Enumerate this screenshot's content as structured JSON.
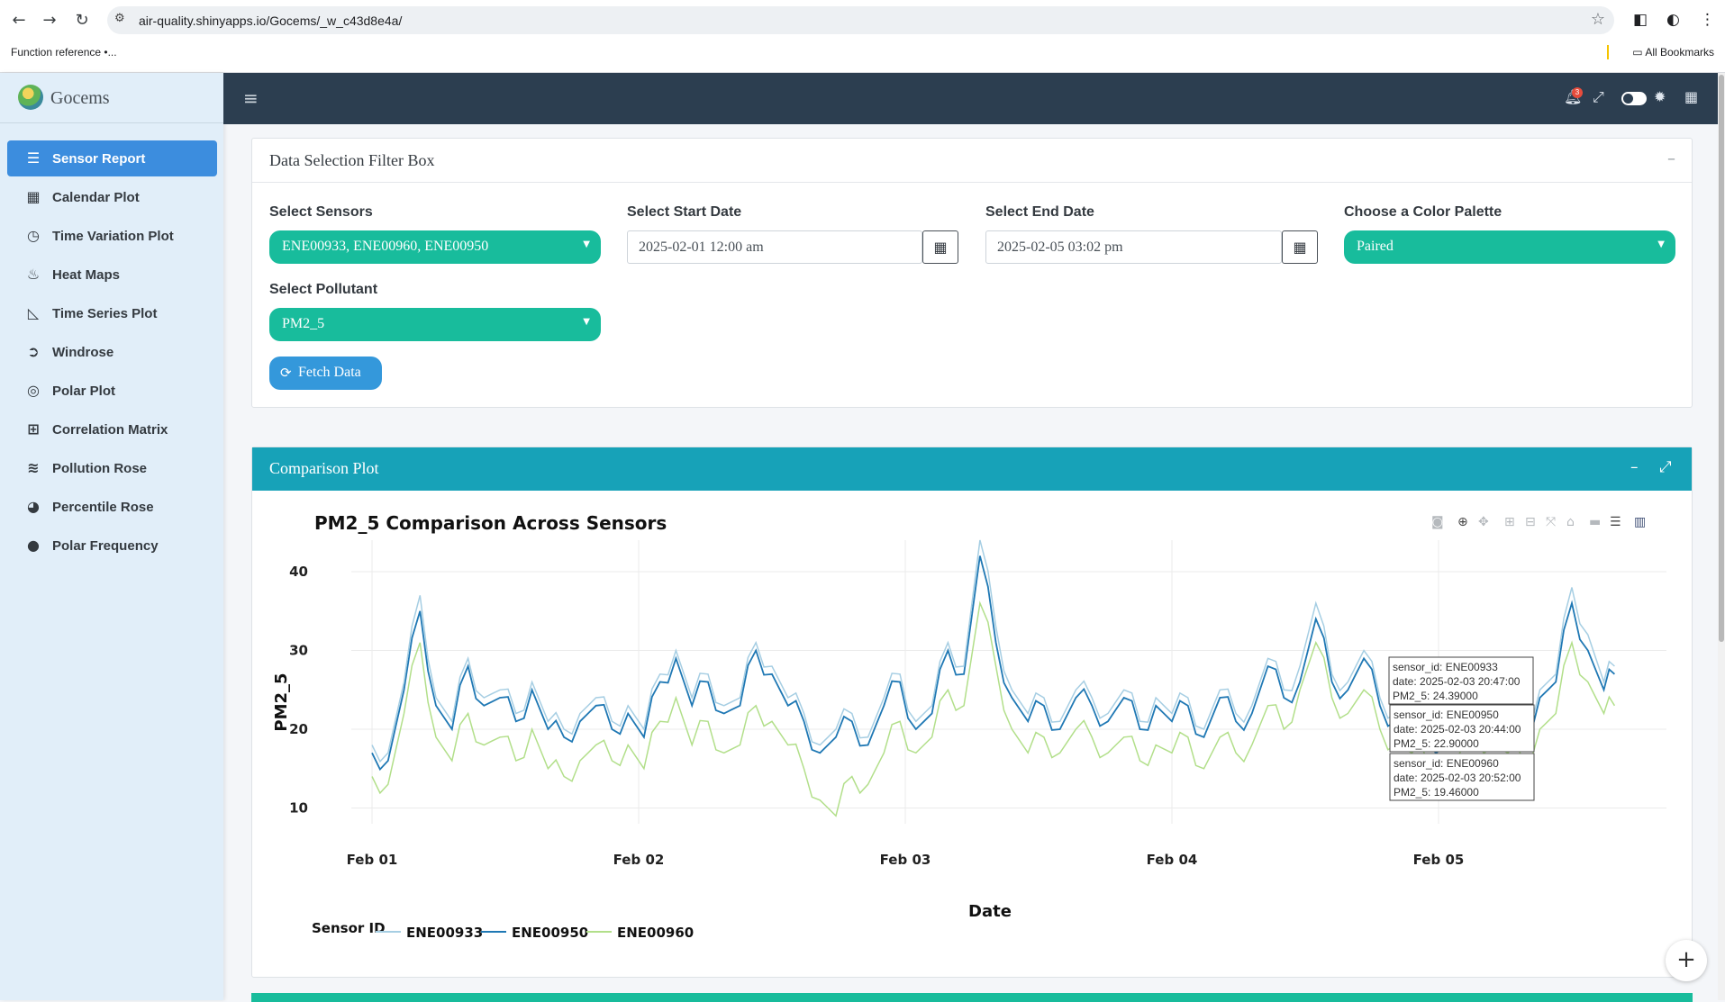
{
  "browser": {
    "back_icon": "←",
    "forward_icon": "→",
    "reload_icon": "↻",
    "url": "air-quality.shinyapps.io/Gocems/_w_c43d8e4a/",
    "bookmark": "Function reference •...",
    "all_bookmarks": "All Bookmarks"
  },
  "sidebar": {
    "brand": "Gocems",
    "items": [
      {
        "label": "Sensor Report",
        "icon": "list-icon"
      },
      {
        "label": "Calendar Plot",
        "icon": "calendar-icon"
      },
      {
        "label": "Time Variation Plot",
        "icon": "clock-icon"
      },
      {
        "label": "Heat Maps",
        "icon": "fire-icon"
      },
      {
        "label": "Time Series Plot",
        "icon": "area-chart-icon"
      },
      {
        "label": "Windrose",
        "icon": "arrow-circle-icon"
      },
      {
        "label": "Polar Plot",
        "icon": "compass-icon"
      },
      {
        "label": "Correlation Matrix",
        "icon": "sitemap-icon"
      },
      {
        "label": "Pollution Rose",
        "icon": "wind-icon"
      },
      {
        "label": "Percentile Rose",
        "icon": "pie-icon"
      },
      {
        "label": "Polar Frequency",
        "icon": "circle-icon"
      }
    ]
  },
  "navbar": {
    "notification_count": "3"
  },
  "filter_box": {
    "title": "Data Selection Filter Box",
    "sensors_label": "Select Sensors",
    "sensors_value": "ENE00933, ENE00960, ENE00950",
    "start_label": "Select Start Date",
    "start_value": "2025-02-01 12:00 am",
    "end_label": "Select End Date",
    "end_value": "2025-02-05 03:02 pm",
    "palette_label": "Choose a Color Palette",
    "palette_value": "Paired",
    "pollutant_label": "Select Pollutant",
    "pollutant_value": "PM2_5",
    "fetch_label": "Fetch Data"
  },
  "comparison": {
    "header": "Comparison Plot"
  },
  "chart_data": {
    "type": "line",
    "title": "PM2_5 Comparison Across Sensors",
    "xlabel": "Date",
    "ylabel": "PM2_5",
    "x_ticks": [
      "Feb 01",
      "Feb 02",
      "Feb 03",
      "Feb 04",
      "Feb 05"
    ],
    "y_ticks": [
      10,
      20,
      30,
      40
    ],
    "ylim": [
      8,
      44
    ],
    "xlim_days": [
      0,
      5.25
    ],
    "grid": true,
    "legend_title": "Sensor ID",
    "legend_position": "bottom-left",
    "series": [
      {
        "name": "ENE00933",
        "color": "#a6cee3",
        "x": [
          0.0,
          0.06,
          0.12,
          0.18,
          0.24,
          0.3,
          0.36,
          0.42,
          0.48,
          0.54,
          0.6,
          0.66,
          0.72,
          0.78,
          0.84,
          0.9,
          0.96,
          1.02,
          1.08,
          1.14,
          1.2,
          1.26,
          1.32,
          1.38,
          1.44,
          1.5,
          1.56,
          1.62,
          1.68,
          1.74,
          1.8,
          1.86,
          1.92,
          1.98,
          2.04,
          2.1,
          2.16,
          2.22,
          2.28,
          2.34,
          2.4,
          2.46,
          2.52,
          2.58,
          2.64,
          2.7,
          2.76,
          2.82,
          2.88,
          2.94,
          3.0,
          3.06,
          3.12,
          3.18,
          3.24,
          3.3,
          3.36,
          3.42,
          3.48,
          3.54,
          3.6,
          3.66,
          3.72,
          3.78,
          3.84,
          3.9,
          3.96,
          4.02,
          4.08,
          4.14,
          4.2,
          4.26,
          4.32,
          4.38,
          4.44,
          4.5,
          4.56,
          4.62,
          4.66
        ],
        "y": [
          18,
          17,
          26,
          37,
          24,
          21,
          29,
          24,
          25,
          22,
          26,
          21,
          20,
          22,
          24,
          21,
          23,
          20,
          27,
          30,
          24,
          27,
          23,
          24,
          31,
          28,
          24,
          22,
          18,
          20,
          22,
          19,
          24,
          27,
          21,
          23,
          31,
          28,
          44,
          33,
          25,
          22,
          24,
          21,
          25,
          24,
          22,
          25,
          21,
          24,
          22,
          24,
          20,
          25,
          22,
          23,
          29,
          25,
          28,
          36,
          27,
          26,
          30,
          24,
          22,
          21,
          20,
          19,
          22,
          24,
          23,
          21,
          20,
          25,
          27,
          38,
          32,
          26,
          28
        ],
        "hover": {
          "sensor_id": "ENE00933",
          "date": "2025-02-03 20:47:00",
          "value": "24.39000"
        }
      },
      {
        "name": "ENE00950",
        "color": "#1f78b4",
        "x": [
          0.0,
          0.06,
          0.12,
          0.18,
          0.24,
          0.3,
          0.36,
          0.42,
          0.48,
          0.54,
          0.6,
          0.66,
          0.72,
          0.78,
          0.84,
          0.9,
          0.96,
          1.02,
          1.08,
          1.14,
          1.2,
          1.26,
          1.32,
          1.38,
          1.44,
          1.5,
          1.56,
          1.62,
          1.68,
          1.74,
          1.8,
          1.86,
          1.92,
          1.98,
          2.04,
          2.1,
          2.16,
          2.22,
          2.28,
          2.34,
          2.4,
          2.46,
          2.52,
          2.58,
          2.64,
          2.7,
          2.76,
          2.82,
          2.88,
          2.94,
          3.0,
          3.06,
          3.12,
          3.18,
          3.24,
          3.3,
          3.36,
          3.42,
          3.48,
          3.54,
          3.6,
          3.66,
          3.72,
          3.78,
          3.84,
          3.9,
          3.96,
          4.02,
          4.08,
          4.14,
          4.2,
          4.26,
          4.32,
          4.38,
          4.44,
          4.5,
          4.56,
          4.62,
          4.66
        ],
        "y": [
          17,
          16,
          25,
          35,
          23,
          20,
          28,
          23,
          24,
          21,
          25,
          20,
          19,
          21,
          23,
          20,
          22,
          19,
          26,
          29,
          23,
          26,
          22,
          23,
          30,
          27,
          23,
          21,
          17,
          19,
          21,
          18,
          23,
          26,
          20,
          22,
          30,
          27,
          42,
          31,
          24,
          21,
          23,
          20,
          24,
          23,
          21,
          24,
          20,
          23,
          21,
          23,
          19,
          24,
          21,
          22,
          28,
          24,
          26,
          34,
          26,
          25,
          29,
          23,
          21,
          20,
          19,
          18,
          21,
          23,
          22,
          20,
          19,
          24,
          26,
          36,
          30,
          25,
          27
        ],
        "hover": {
          "sensor_id": "ENE00950",
          "date": "2025-02-03 20:44:00",
          "value": "22.90000"
        }
      },
      {
        "name": "ENE00960",
        "color": "#b2df8a",
        "x": [
          0.0,
          0.06,
          0.12,
          0.18,
          0.24,
          0.3,
          0.36,
          0.42,
          0.48,
          0.54,
          0.6,
          0.66,
          0.72,
          0.78,
          0.84,
          0.9,
          0.96,
          1.02,
          1.08,
          1.14,
          1.2,
          1.26,
          1.32,
          1.38,
          1.44,
          1.5,
          1.56,
          1.62,
          1.68,
          1.74,
          1.8,
          1.86,
          1.92,
          1.98,
          2.04,
          2.1,
          2.16,
          2.22,
          2.28,
          2.34,
          2.4,
          2.46,
          2.52,
          2.58,
          2.64,
          2.7,
          2.76,
          2.82,
          2.88,
          2.94,
          3.0,
          3.06,
          3.12,
          3.18,
          3.24,
          3.3,
          3.36,
          3.42,
          3.48,
          3.54,
          3.6,
          3.66,
          3.72,
          3.78,
          3.84,
          3.9,
          3.96,
          4.02,
          4.08,
          4.14,
          4.2,
          4.26,
          4.32,
          4.38,
          4.44,
          4.5,
          4.56,
          4.62,
          4.66
        ],
        "y": [
          14,
          13,
          22,
          31,
          19,
          16,
          22,
          18,
          19,
          16,
          20,
          15,
          14,
          16,
          18,
          16,
          18,
          15,
          21,
          24,
          18,
          21,
          17,
          18,
          23,
          21,
          18,
          15,
          11,
          9,
          14,
          13,
          17,
          21,
          17,
          19,
          25,
          23,
          36,
          28,
          20,
          17,
          19,
          17,
          20,
          19,
          17,
          19,
          16,
          18,
          17,
          19,
          15,
          19,
          17,
          18,
          23,
          20,
          25,
          31,
          24,
          22,
          25,
          20,
          18,
          17,
          16,
          15,
          17,
          19,
          18,
          17,
          16,
          20,
          22,
          31,
          26,
          22,
          23
        ],
        "hover": {
          "sensor_id": "ENE00960",
          "date": "2025-02-03 20:52:00",
          "value": "19.46000"
        }
      }
    ]
  }
}
